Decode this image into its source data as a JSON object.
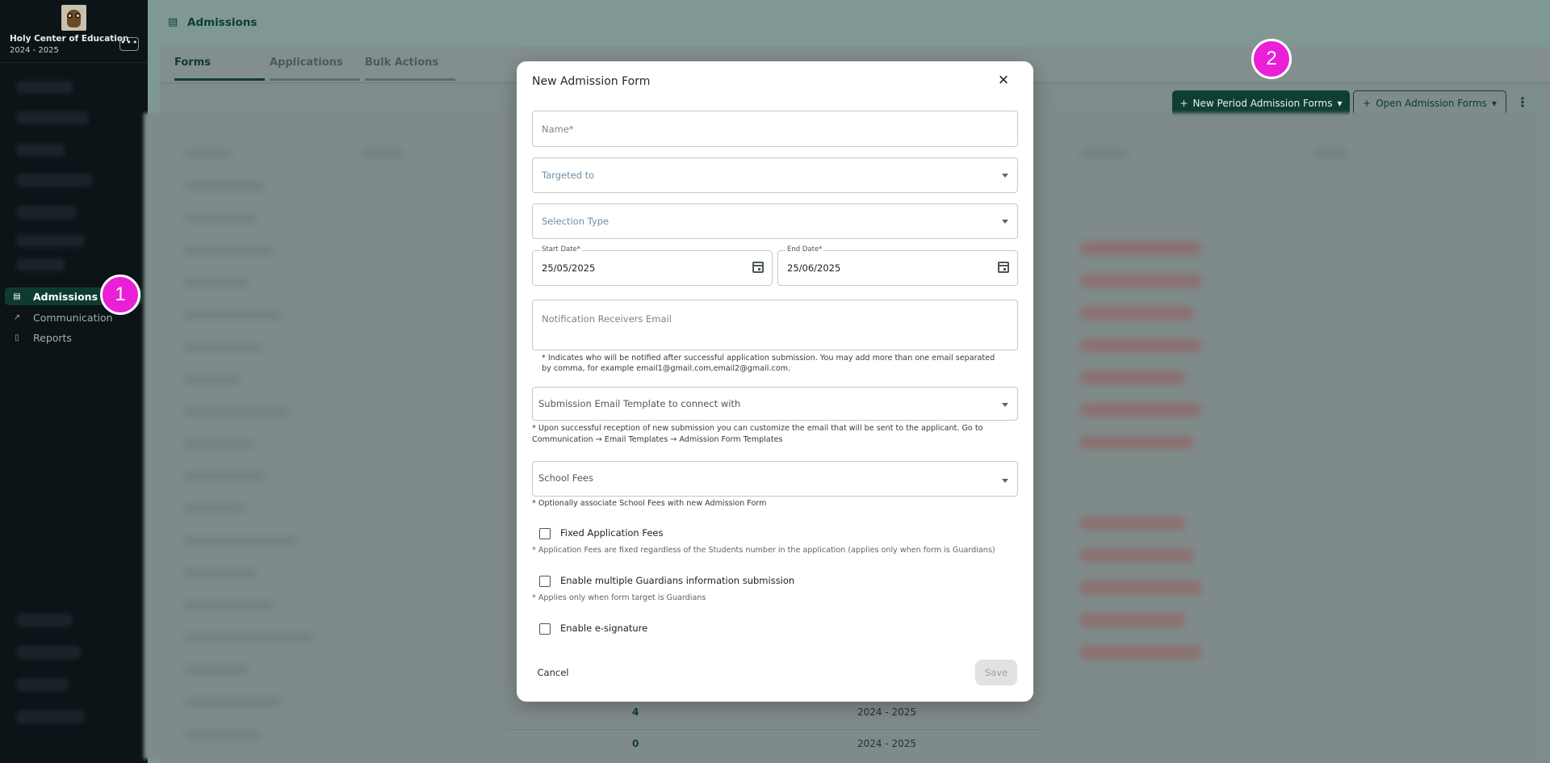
{
  "sidebar": {
    "school_name": "Holy Center of Education",
    "school_year": "2024 - 2025",
    "menu_glyph": "•••",
    "items": [
      {
        "label": "Admissions",
        "icon": "admissions-icon"
      },
      {
        "label": "Communication",
        "icon": "arrow-up-right-icon"
      },
      {
        "label": "Reports",
        "icon": "document-icon"
      }
    ]
  },
  "header": {
    "title": "Admissions"
  },
  "tabs": [
    "Forms",
    "Applications",
    "Bulk Actions"
  ],
  "toolbar": {
    "new_period_label": "New Period Admission Forms",
    "open_label": "Open Admission Forms",
    "plus_glyph": "+",
    "caret_glyph": "▾",
    "kebab_glyph": "⋮"
  },
  "table": {
    "rows": [
      {
        "count": "4",
        "year": "2024 - 2025"
      },
      {
        "count": "0",
        "year": "2024 - 2025"
      }
    ]
  },
  "badges": [
    "1",
    "2"
  ],
  "modal": {
    "title": "New Admission Form",
    "close_glyph": "×",
    "name_placeholder": "Name*",
    "targeted_placeholder": "Targeted to",
    "selection_type_placeholder": "Selection Type",
    "start_date_label": "Start Date*",
    "start_date_value": "25/05/2025",
    "end_date_label": "End Date*",
    "end_date_value": "25/06/2025",
    "notification_placeholder": "Notification Receivers Email",
    "notification_hint": "* Indicates who will be notified after successful application submission. You may add more than one email separated by comma, for example email1@gmail.com,email2@gmail.com.",
    "submission_template_placeholder": "Submission Email Template to connect with",
    "submission_hint_line1": "* Upon successful reception of new submission you can customize the email that will be sent to the applicant. Go to",
    "submission_hint_line2": "Communication → Email Templates → Admission Form Templates",
    "school_fees_placeholder": "School Fees",
    "school_fees_hint": "* Optionally associate School Fees with new Admission Form",
    "fixed_fees_label": "Fixed Application Fees",
    "fixed_fees_hint": "* Application Fees are fixed regardless of the Students number in the application (applies only when form is Guardians)",
    "multi_guardians_label": "Enable multiple Guardians information submission",
    "multi_guardians_hint": "* Applies only when form target is Guardians",
    "esignature_label": "Enable e-signature",
    "cancel_label": "Cancel",
    "save_label": "Save"
  },
  "colors": {
    "primary": "#0e3b30",
    "sidebar_bg": "#0c1418",
    "badge": "#ea1fd7",
    "overlay": "#7f9894"
  }
}
